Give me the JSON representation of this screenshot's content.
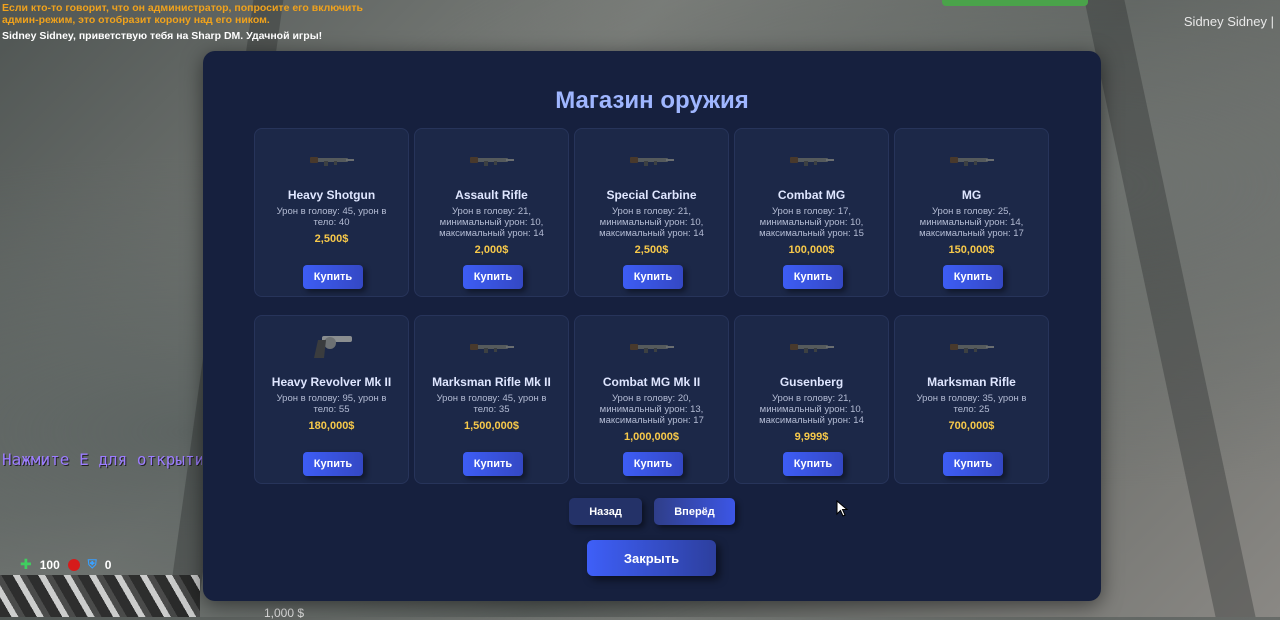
{
  "chat": {
    "warning": "Если кто-то говорит, что он администратор, попросите его включить админ-режим, это отобразит корону над его ником.",
    "greeting": "Sidney Sidney, приветствую тебя на Sharp DM. Удачной игры!"
  },
  "player_name": "Sidney Sidney |",
  "hint": "Нажмите E для открытия магазина",
  "hud": {
    "health": "100",
    "armor": "0"
  },
  "money_below": "1,000 $",
  "shop": {
    "title": "Магазин оружия",
    "buy_label": "Купить",
    "back_label": "Назад",
    "forward_label": "Вперёд",
    "close_label": "Закрыть",
    "weapons": [
      {
        "name": "Heavy Shotgun",
        "desc": "Урон в голову: 45, урон в тело: 40",
        "price": "2,500$",
        "icon": "shotgun-icon"
      },
      {
        "name": "Assault Rifle",
        "desc": "Урон в голову: 21, минимальный урон: 10, максимальный урон: 14",
        "price": "2,000$",
        "icon": "rifle-icon"
      },
      {
        "name": "Special Carbine",
        "desc": "Урон в голову: 21, минимальный урон: 10, максимальный урон: 14",
        "price": "2,500$",
        "icon": "carbine-icon"
      },
      {
        "name": "Combat MG",
        "desc": "Урон в голову: 17, минимальный урон: 10, максимальный урон: 15",
        "price": "100,000$",
        "icon": "machine-gun-icon"
      },
      {
        "name": "MG",
        "desc": "Урон в голову: 25, минимальный урон: 14, максимальный урон: 17",
        "price": "150,000$",
        "icon": "machine-gun-icon"
      },
      {
        "name": "Heavy Revolver Mk II",
        "desc": "Урон в голову: 95, урон в тело: 55",
        "price": "180,000$",
        "icon": "revolver-icon"
      },
      {
        "name": "Marksman Rifle Mk II",
        "desc": "Урон в голову: 45, урон в тело: 35",
        "price": "1,500,000$",
        "icon": "sniper-rifle-icon"
      },
      {
        "name": "Combat MG Mk II",
        "desc": "Урон в голову: 20, минимальный урон: 13, максимальный урон: 17",
        "price": "1,000,000$",
        "icon": "machine-gun-icon"
      },
      {
        "name": "Gusenberg",
        "desc": "Урон в голову: 21, минимальный урон: 10, максимальный урон: 14",
        "price": "9,999$",
        "icon": "tommy-gun-icon"
      },
      {
        "name": "Marksman Rifle",
        "desc": "Урон в голову: 35, урон в тело: 25",
        "price": "700,000$",
        "icon": "sniper-rifle-icon"
      }
    ]
  },
  "colors": {
    "panel": "#16203e",
    "title": "#9fb6ff",
    "price": "#f7c94a",
    "accent": "#3d5df5"
  }
}
